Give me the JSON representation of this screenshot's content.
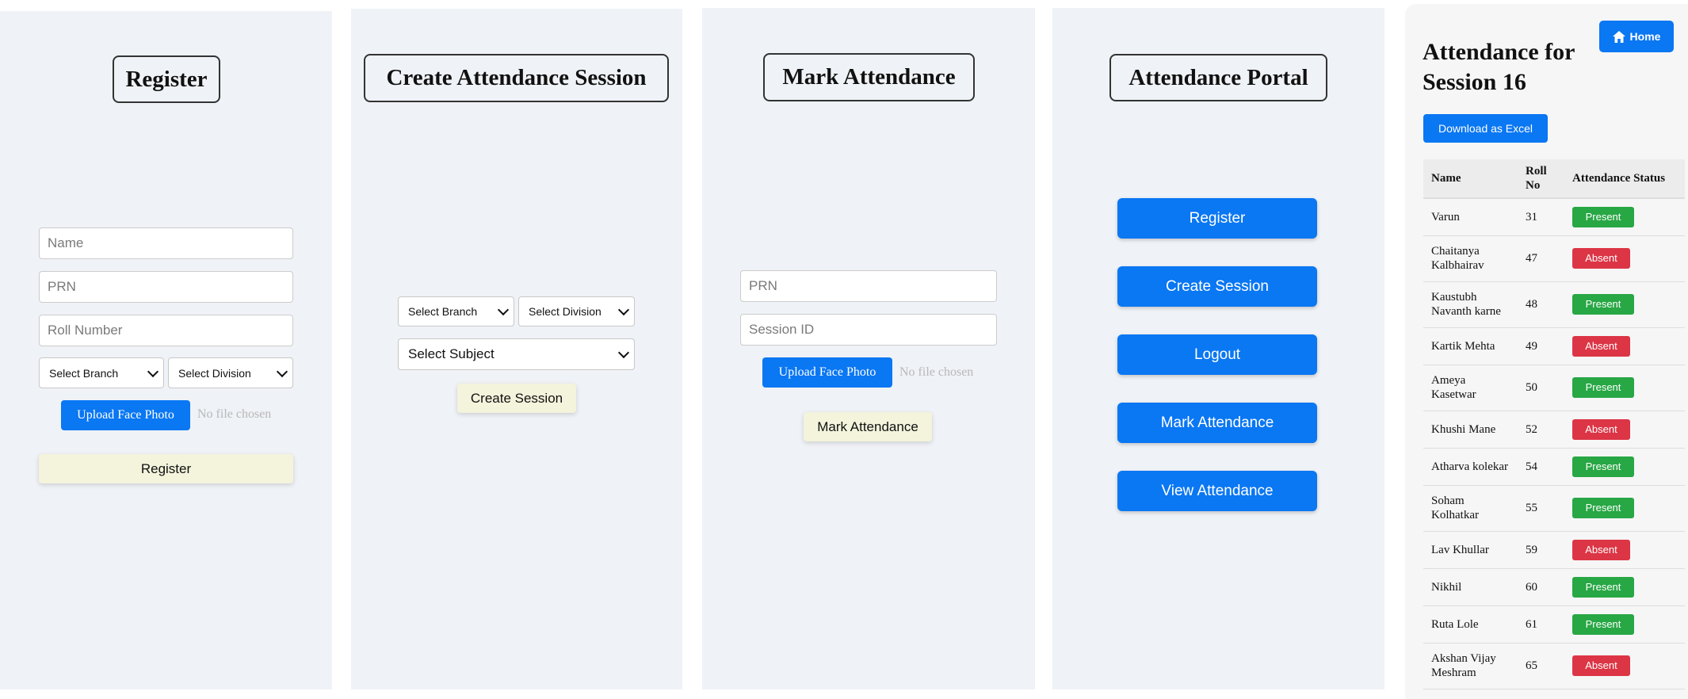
{
  "register_panel": {
    "title": "Register",
    "name_placeholder": "Name",
    "prn_placeholder": "PRN",
    "roll_placeholder": "Roll Number",
    "branch_select": "Select Branch",
    "division_select": "Select Division",
    "upload_label": "Upload Face Photo",
    "no_file": "No file chosen",
    "submit_label": "Register"
  },
  "session_panel": {
    "title": "Create Attendance Session",
    "branch_select": "Select Branch",
    "division_select": "Select Division",
    "subject_select": "Select Subject",
    "submit_label": "Create Session"
  },
  "mark_panel": {
    "title": "Mark Attendance",
    "prn_placeholder": "PRN",
    "session_placeholder": "Session ID",
    "upload_label": "Upload Face Photo",
    "no_file": "No file chosen",
    "submit_label": "Mark Attendance"
  },
  "portal_panel": {
    "title": "Attendance Portal",
    "buttons": [
      "Register",
      "Create Session",
      "Logout",
      "Mark Attendance",
      "View Attendance"
    ]
  },
  "attendance_view": {
    "home_label": "Home",
    "title": "Attendance for Session 16",
    "download_label": "Download as Excel",
    "columns": [
      "Name",
      "Roll No",
      "Attendance Status"
    ],
    "rows": [
      {
        "name": "Varun",
        "roll": "31",
        "status": "Present"
      },
      {
        "name": "Chaitanya Kalbhairav",
        "roll": "47",
        "status": "Absent"
      },
      {
        "name": "Kaustubh Navanth karne",
        "roll": "48",
        "status": "Present"
      },
      {
        "name": "Kartik Mehta",
        "roll": "49",
        "status": "Absent"
      },
      {
        "name": "Ameya Kasetwar",
        "roll": "50",
        "status": "Present"
      },
      {
        "name": "Khushi Mane",
        "roll": "52",
        "status": "Absent"
      },
      {
        "name": "Atharva kolekar",
        "roll": "54",
        "status": "Present"
      },
      {
        "name": "Soham Kolhatkar",
        "roll": "55",
        "status": "Present"
      },
      {
        "name": "Lav Khullar",
        "roll": "59",
        "status": "Absent"
      },
      {
        "name": "Nikhil",
        "roll": "60",
        "status": "Present"
      },
      {
        "name": "Ruta Lole",
        "roll": "61",
        "status": "Present"
      },
      {
        "name": "Akshan Vijay Meshram",
        "roll": "65",
        "status": "Absent"
      }
    ]
  },
  "colors": {
    "primary": "#0a77f3",
    "present": "#28a745",
    "absent": "#dc3545",
    "cream_button": "#f4f3dc",
    "panel_bg": "#eff2f6"
  }
}
